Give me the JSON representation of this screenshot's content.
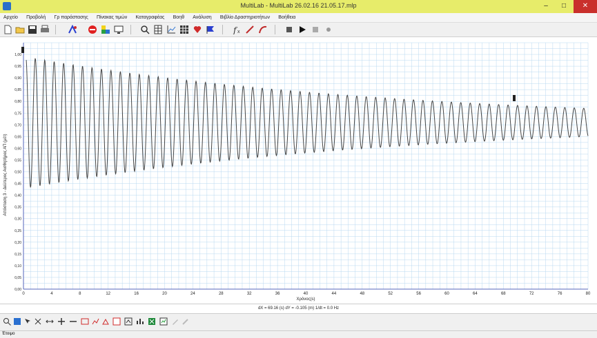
{
  "window": {
    "title": "MultiLab - MultiLab 26.02.16 21.05.17.mlp",
    "minimize": "–",
    "maximize": "□",
    "close": "✕"
  },
  "menu": [
    "Αρχείο",
    "Προβολή",
    "Γρ παράστασης",
    "Πίνακας τιμών",
    "Καταγραφέας",
    "Βοηθ",
    "Ανάλυση",
    "Βιβλίο Δραστηριοτήτων",
    "Βοήθεια"
  ],
  "toolbar_icons": [
    "new-file-icon",
    "open-folder-icon",
    "save-icon",
    "print-icon",
    "sensor-icon",
    "stop-record-icon",
    "colors-icon",
    "monitor-icon",
    "search-icon",
    "table-icon",
    "graph-icon",
    "grid-icon",
    "heart-icon",
    "flag-icon",
    "function-icon",
    "line-icon",
    "curve-icon",
    "stop-icon",
    "play-icon",
    "pause-icon",
    "record-icon"
  ],
  "colors": {
    "grid": "#b8d8f0",
    "trace": "#444444",
    "titlebar": "#e7ec6a",
    "close": "#c9302c"
  },
  "chart_data": {
    "type": "line",
    "ylabel": "Απόσταση 3 - Δεύτερος Αισθητήρας ΑΠ (μέτ)",
    "xlabel": "Χρόνος(s)",
    "xlim": [
      0,
      80
    ],
    "ylim": [
      0,
      1.05
    ],
    "x_ticks": [
      0,
      4,
      8,
      12,
      16,
      20,
      24,
      28,
      32,
      36,
      40,
      44,
      48,
      52,
      56,
      60,
      64,
      68,
      72,
      76,
      80
    ],
    "y_ticks": [
      "0,00",
      "0,05",
      "0,10",
      "0,15",
      "0,20",
      "0,25",
      "0,30",
      "0,35",
      "0,40",
      "0,45",
      "0,50",
      "0,55",
      "0,60",
      "0,65",
      "0,70",
      "0,75",
      "0,80",
      "0,85",
      "0,90",
      "0,95",
      "1,00"
    ],
    "signal": {
      "description": "damped oscillation",
      "center": 0.71,
      "initial_amplitude": 0.28,
      "final_amplitude": 0.06,
      "period": 1.34,
      "start_x": 0.4,
      "end_x": 80
    }
  },
  "readout": "dX = 69.16 (s) dY = -0.105 (m) 1/dt = 0.0 Hz",
  "bottom_icons": [
    "zoom-icon",
    "pan-icon",
    "cursor-icon",
    "cross-icon",
    "plus-icon",
    "minus-icon",
    "fit-icon",
    "scale-x-icon",
    "scale-y-icon",
    "marker-icon",
    "text-icon",
    "export-icon",
    "excel-icon",
    "chart-icon",
    "pencil-icon",
    "edit-icon"
  ],
  "status": "Έτοιμο"
}
